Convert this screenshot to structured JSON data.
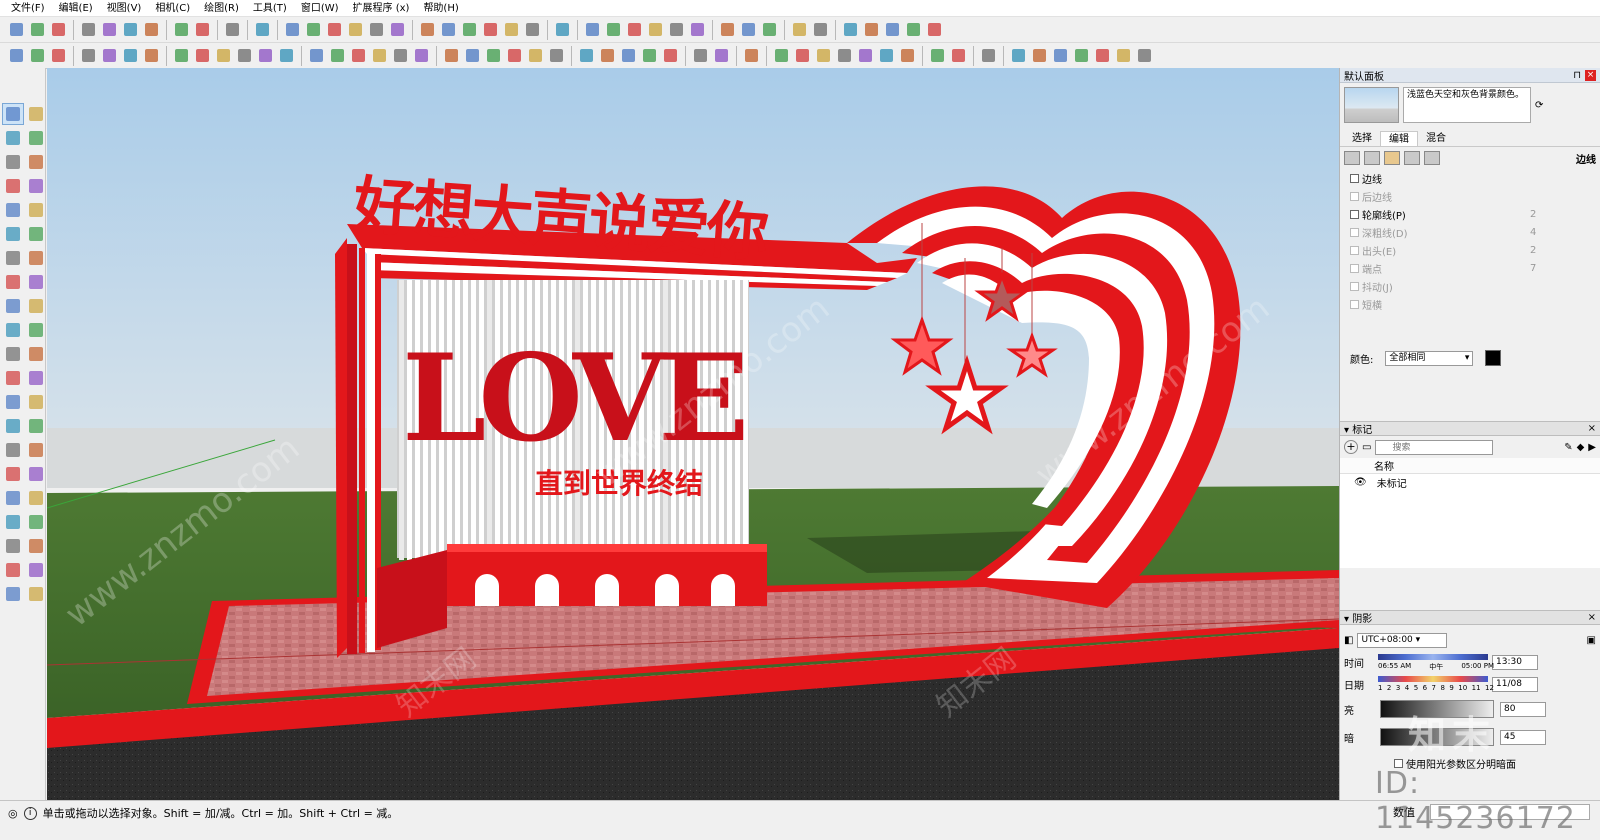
{
  "menu": [
    "文件(F)",
    "编辑(E)",
    "视图(V)",
    "相机(C)",
    "绘图(R)",
    "工具(T)",
    "窗口(W)",
    "扩展程序 (x)",
    "帮助(H)"
  ],
  "icons": {
    "toolbar_row1": [
      "new-file-icon",
      "open-file-icon",
      "save-icon",
      "sep",
      "cut-icon",
      "copy-icon",
      "paste-icon",
      "erase-icon",
      "sep",
      "undo-icon",
      "redo-icon",
      "sep",
      "print-icon",
      "sep",
      "model-info-icon",
      "sep",
      "cube-face-icon",
      "cube-wire-icon",
      "cube-hidden-icon",
      "cube-shaded-icon",
      "cube-texture-icon",
      "cube-mono-icon",
      "sep",
      "iso-view-icon",
      "top-view-icon",
      "front-view-icon",
      "right-view-icon",
      "back-view-icon",
      "left-view-icon",
      "sep",
      "component-icon",
      "sep",
      "xray-icon",
      "back-edges-icon",
      "wireframe-icon",
      "hidden-line-icon",
      "shaded-icon",
      "shaded-texture-icon",
      "sep",
      "section-plane-icon",
      "section-cut-icon",
      "section-fill-icon",
      "sep",
      "sandbox-icon",
      "terrain-icon",
      "sep",
      "geo-location-icon",
      "photo-texture-icon",
      "warehouse-icon",
      "extension-icon",
      "share-icon"
    ],
    "toolbar_row2": [
      "frame-icon",
      "frame-alt-icon",
      "frame-split-icon",
      "sep",
      "stair-icon",
      "rail-icon",
      "bar-icon",
      "chart-icon",
      "sep",
      "align-icon",
      "distribute-icon",
      "join-icon",
      "arc-tool-icon",
      "curve-tool-icon",
      "split-icon",
      "sep",
      "weld-icon",
      "offset-icon",
      "extrude-icon",
      "taper-icon",
      "fillet-icon",
      "chamfer-icon",
      "sep",
      "loft-icon",
      "wave-icon",
      "spline-icon",
      "curl-icon",
      "bulb-icon",
      "fence-icon",
      "sep",
      "pyramid-icon",
      "grid-icon",
      "box-icon",
      "pen-icon",
      "brush-icon",
      "sep",
      "render-icon",
      "material-icon",
      "sep",
      "pipe-icon",
      "sep",
      "tag-red-icon",
      "tag-orange-icon",
      "tag-yellow-icon",
      "tag-green-icon",
      "tag-blue-icon",
      "tag-purple-icon",
      "tag-pink-icon",
      "sep",
      "shield-icon",
      "fruit-icon",
      "sep",
      "knife-icon",
      "sep",
      "skin-icon",
      "xy-icon",
      "lasso-icon",
      "play-icon",
      "stop-icon",
      "export-icon",
      "help-icon"
    ],
    "leftbar": [
      "select-arrow-icon",
      "orbit-icon",
      "paint-bucket-icon",
      "eraser-icon",
      "component-select-icon",
      "pencil-icon",
      "line-icon",
      "freehand-icon",
      "rectangle-icon",
      "rotated-rect-icon",
      "circle-icon",
      "polygon-icon",
      "arc-icon",
      "arc2-icon",
      "pie-icon",
      "arc3-icon",
      "move-icon",
      "push-pull-icon",
      "rotate-icon",
      "follow-me-icon",
      "scale-icon",
      "offset-icon",
      "tape-measure-icon",
      "dimension-icon",
      "protractor-icon",
      "text-icon",
      "axes-icon",
      "3d-text-icon",
      "orbit-tool-icon",
      "pan-icon",
      "zoom-icon",
      "zoom-window-icon",
      "zoom-extents-icon",
      "previous-view-icon",
      "position-camera-icon",
      "look-around-icon",
      "walk-icon",
      "section-icon",
      "sandbox-contour-icon",
      "sandbox-mesh-icon",
      "stamp-icon",
      "drape-icon"
    ]
  },
  "scene": {
    "headline": "好想大声说爱你",
    "love_text": "LOVE",
    "subline": "直到世界终结",
    "watermark_site": "www.znzmo.com",
    "watermark_cn": "知末网"
  },
  "tray": {
    "title": "默认面板",
    "style_desc": "浅蓝色天空和灰色背景颜色。",
    "tabs": [
      "选择",
      "编辑",
      "混合"
    ],
    "active_tab": "编辑",
    "edge_label": "边线",
    "edge_options": [
      {
        "label": "边线",
        "checked": false,
        "enabled": true,
        "value": ""
      },
      {
        "label": "后边线",
        "checked": false,
        "enabled": false,
        "value": ""
      },
      {
        "label": "轮廓线(P)",
        "checked": false,
        "enabled": true,
        "value": "2"
      },
      {
        "label": "深粗线(D)",
        "checked": false,
        "enabled": false,
        "value": "4"
      },
      {
        "label": "出头(E)",
        "checked": false,
        "enabled": false,
        "value": "2"
      },
      {
        "label": "端点",
        "checked": false,
        "enabled": false,
        "value": "7"
      },
      {
        "label": "抖动(J)",
        "checked": false,
        "enabled": false,
        "value": ""
      },
      {
        "label": "短横",
        "checked": false,
        "enabled": false,
        "value": ""
      }
    ],
    "color_label": "颜色:",
    "color_value": "全部相同",
    "color_swatch": "#000000",
    "tags": {
      "title": "标记",
      "search_placeholder": "搜索",
      "col_name": "名称",
      "rows": [
        "未标记"
      ]
    },
    "shadows": {
      "title": "阴影",
      "timezone": "UTC+08:00",
      "time_label": "时间",
      "time_ticks": [
        "06:55 AM",
        "中午",
        "05:00 PM"
      ],
      "time_value": "13:30",
      "date_label": "日期",
      "date_ticks": [
        "1",
        "2",
        "3",
        "4",
        "5",
        "6",
        "7",
        "8",
        "9",
        "10",
        "11",
        "12"
      ],
      "date_value": "11/08",
      "light_label": "亮",
      "light_value": "80",
      "dark_label": "暗",
      "dark_value": "45",
      "sun_option": "使用阳光参数区分明暗面"
    }
  },
  "status": {
    "message": "单击或拖动以选择对象。Shift = 加/减。Ctrl = 加。Shift + Ctrl = 减。",
    "measure_label": "数值"
  },
  "watermark": {
    "id_text": "ID: 1145236172",
    "logo_text": "知末"
  }
}
